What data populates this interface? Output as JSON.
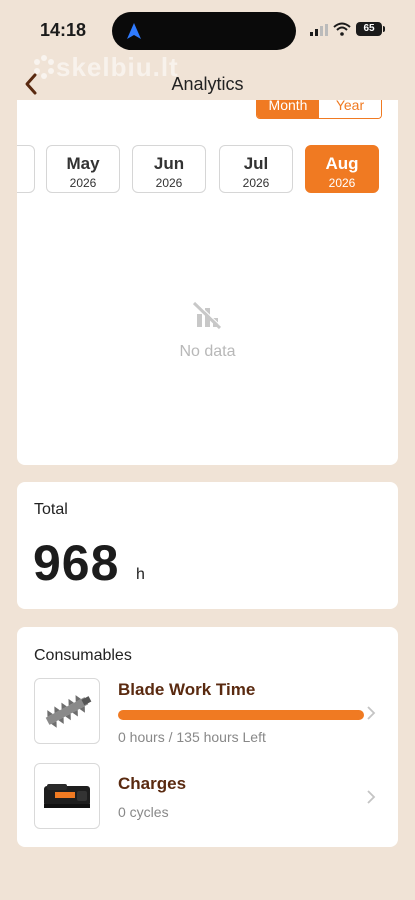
{
  "status_bar": {
    "time": "14:18",
    "battery": "65"
  },
  "watermark": "skelbiu.lt",
  "header": {
    "title": "Analytics"
  },
  "period_toggle": {
    "options": [
      "Month",
      "Year"
    ],
    "selected": "Month"
  },
  "months": [
    {
      "name": "May",
      "year": "2026"
    },
    {
      "name": "Jun",
      "year": "2026"
    },
    {
      "name": "Jul",
      "year": "2026"
    },
    {
      "name": "Aug",
      "year": "2026",
      "selected": true
    }
  ],
  "chart": {
    "empty_text": "No data"
  },
  "total": {
    "label": "Total",
    "value": "968",
    "unit": "h"
  },
  "consumables": {
    "title": "Consumables",
    "items": [
      {
        "name": "Blade Work Time",
        "status": "0 hours / 135 hours Left",
        "progress": 1.0,
        "icon": "hedge-trimmer-blade-image"
      },
      {
        "name": "Charges",
        "status": "0 cycles",
        "icon": "battery-pack-image"
      }
    ]
  },
  "colors": {
    "accent": "#f07a22",
    "background": "#f0e3d6",
    "item_title": "#5a2a10"
  }
}
